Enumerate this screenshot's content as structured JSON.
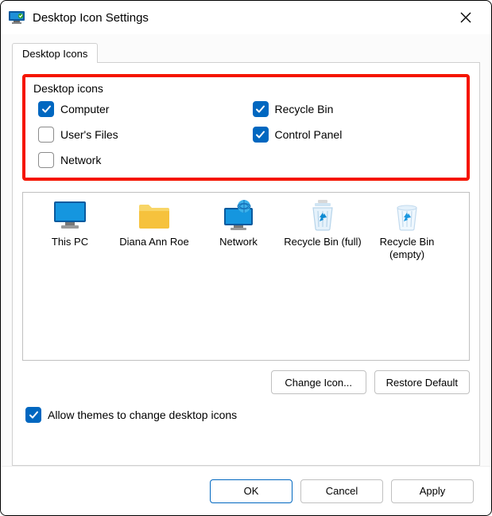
{
  "window": {
    "title": "Desktop Icon Settings"
  },
  "tabs": {
    "desktop_icons": "Desktop Icons"
  },
  "group": {
    "title": "Desktop icons",
    "items": {
      "computer": {
        "label": "Computer",
        "checked": true
      },
      "recycle_bin": {
        "label": "Recycle Bin",
        "checked": true
      },
      "users_files": {
        "label": "User's Files",
        "checked": false
      },
      "control_panel": {
        "label": "Control Panel",
        "checked": true
      },
      "network": {
        "label": "Network",
        "checked": false
      }
    }
  },
  "icons": {
    "this_pc": "This PC",
    "user": "Diana Ann Roe",
    "network": "Network",
    "recycle_full": "Recycle Bin (full)",
    "recycle_empty": "Recycle Bin (empty)"
  },
  "buttons": {
    "change_icon": "Change Icon...",
    "restore_default": "Restore Default",
    "ok": "OK",
    "cancel": "Cancel",
    "apply": "Apply"
  },
  "themes": {
    "label": "Allow themes to change desktop icons",
    "checked": true
  },
  "colors": {
    "accent": "#0067c0",
    "highlight": "#f51500"
  }
}
